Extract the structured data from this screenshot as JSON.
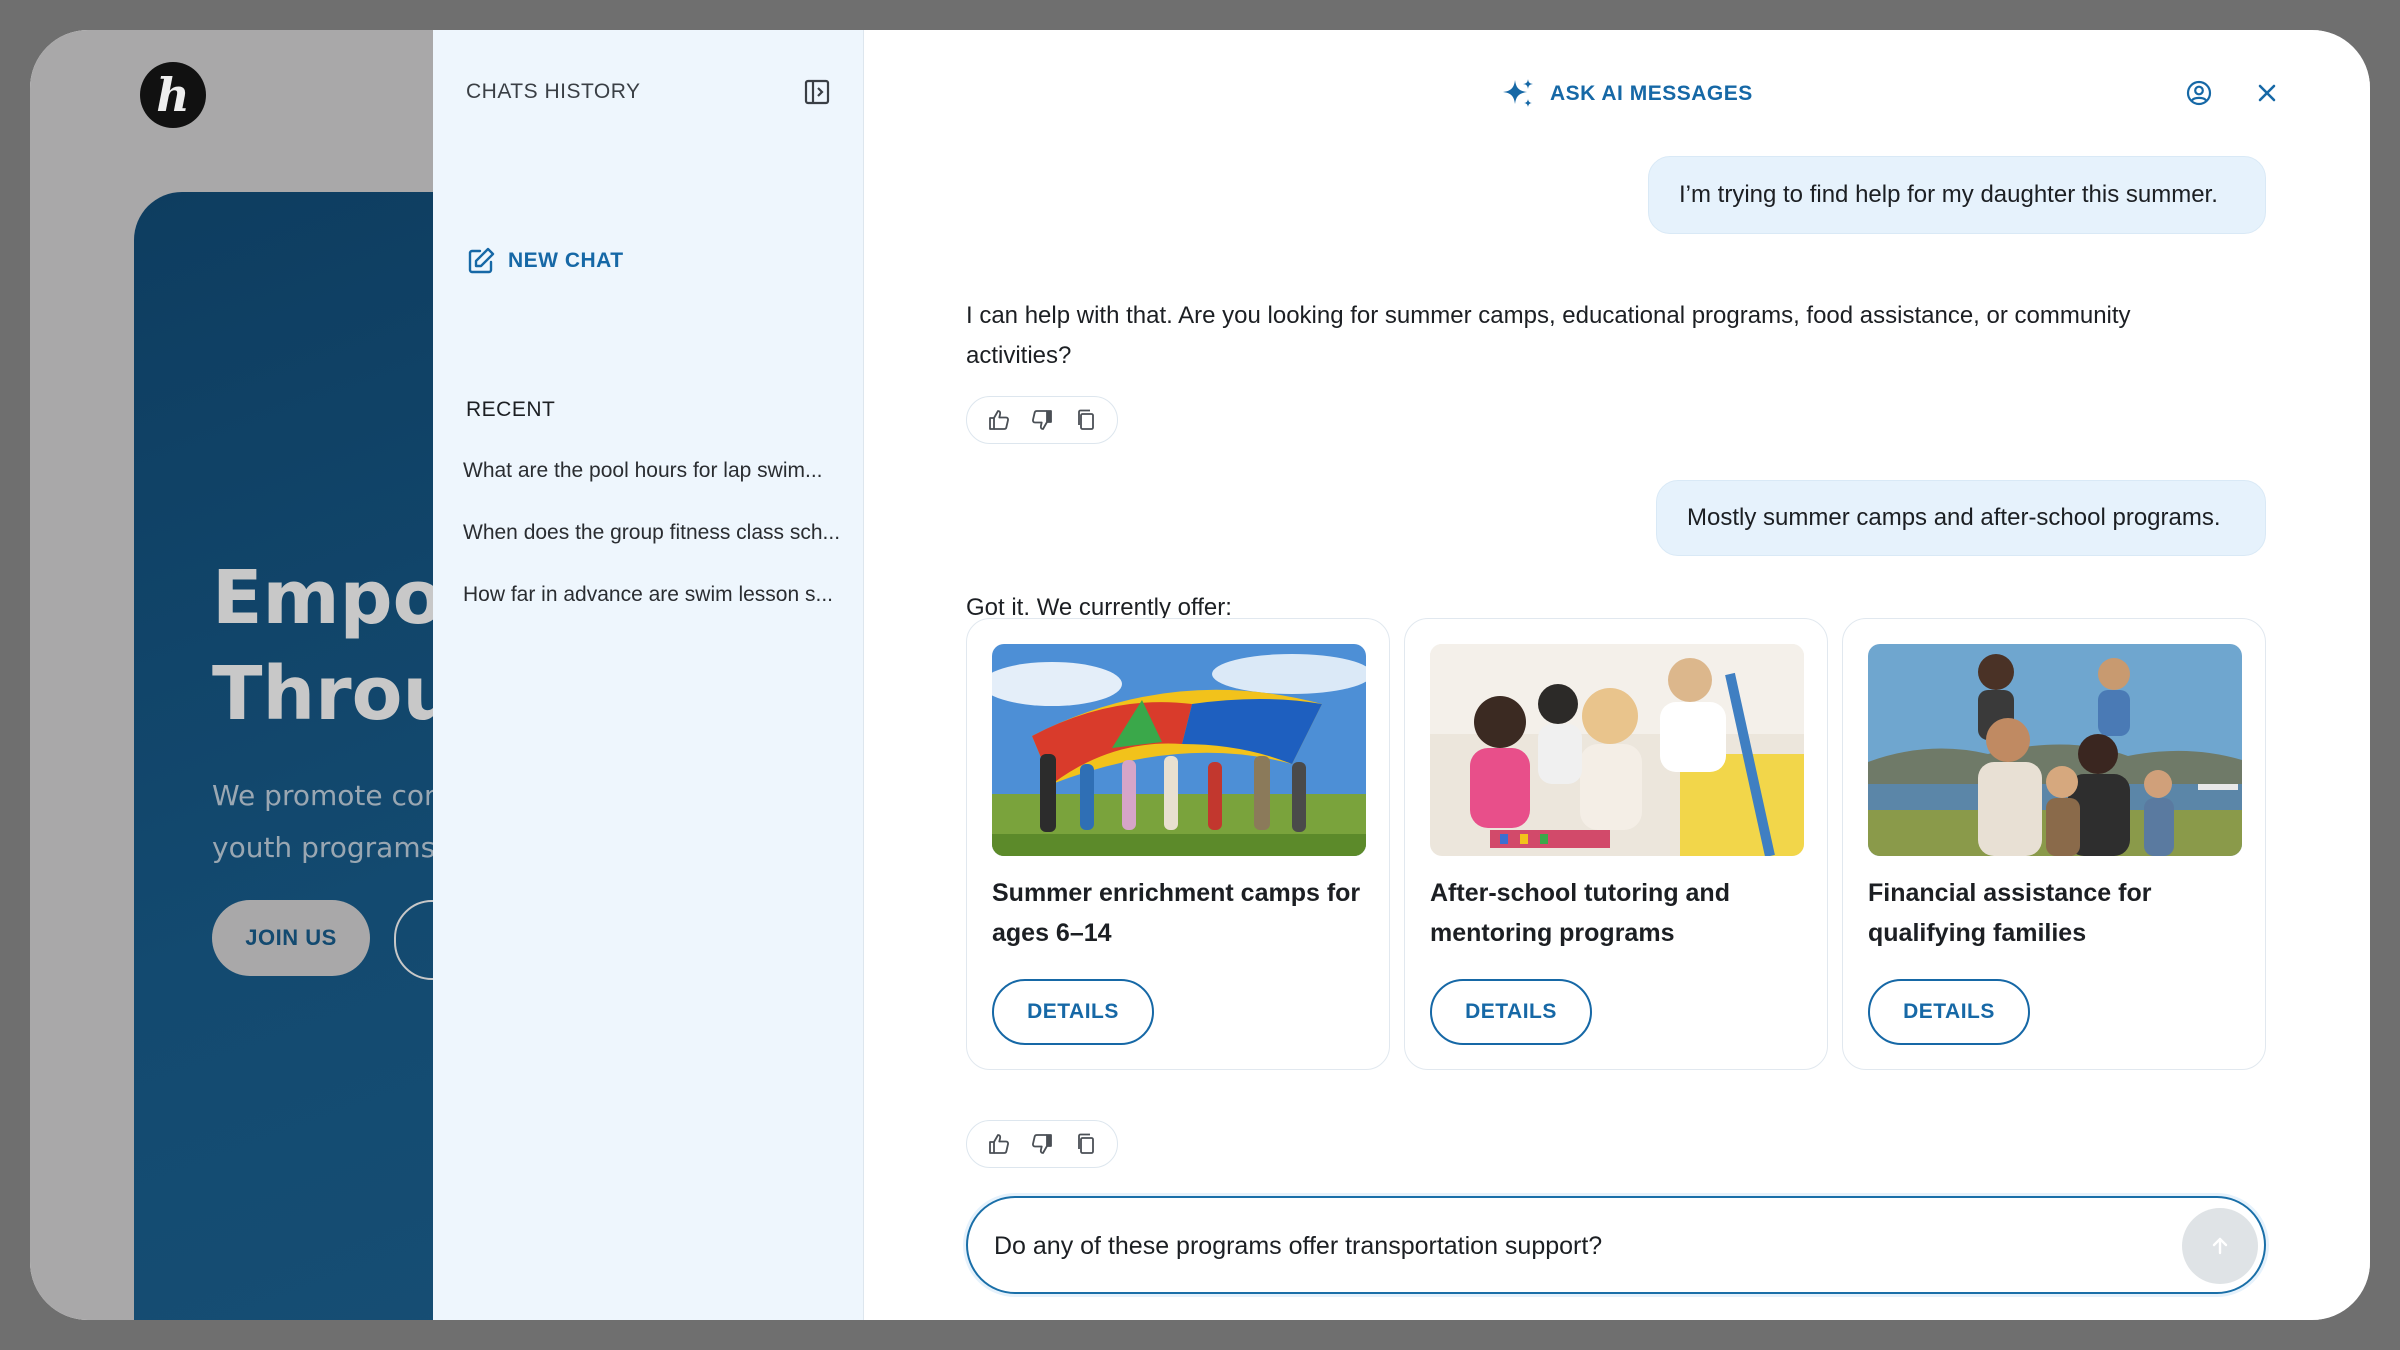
{
  "background_site": {
    "headline_line1": "Empow",
    "headline_line2": "Throug",
    "subtitle_line1": "We promote com",
    "subtitle_line2": "youth programs,",
    "join_label": "JOIN US"
  },
  "sidebar": {
    "title": "CHATS HISTORY",
    "new_chat_label": "NEW CHAT",
    "recent_label": "RECENT",
    "recent_items": [
      "What are the pool hours for lap swim...",
      "When does the group fitness class sch...",
      "How far in advance are swim lesson s..."
    ]
  },
  "header": {
    "title": "ASK AI MESSAGES"
  },
  "messages": [
    {
      "role": "user",
      "text": "I’m trying to find help for my daughter this summer."
    },
    {
      "role": "assistant",
      "text": "I can help with that. Are you looking for summer camps, educational programs, food assistance, or community activities?"
    },
    {
      "role": "user",
      "text": "Mostly summer camps and after-school programs."
    },
    {
      "role": "assistant",
      "text": "Got it. We currently offer:"
    }
  ],
  "cards": [
    {
      "title": "Summer enrichment camps for ages 6–14",
      "button": "DETAILS"
    },
    {
      "title": "After-school tutoring and mentoring programs",
      "button": "DETAILS"
    },
    {
      "title": "Financial assistance for qualifying families",
      "button": "DETAILS"
    }
  ],
  "composer": {
    "value": "Do any of these programs offer transportation support?"
  },
  "icons": {
    "sparkle": "sparkle-icon",
    "user": "user-circle-icon",
    "close": "close-icon",
    "new_chat": "edit-icon",
    "collapse": "sidebar-collapse-icon",
    "thumbs_up": "thumbs-up-icon",
    "thumbs_down": "thumbs-down-icon",
    "copy": "copy-icon",
    "send": "arrow-up-icon"
  },
  "colors": {
    "accent": "#1668a6",
    "user_bubble": "#e6f2fc",
    "sidebar_bg": "#eef6fd"
  }
}
